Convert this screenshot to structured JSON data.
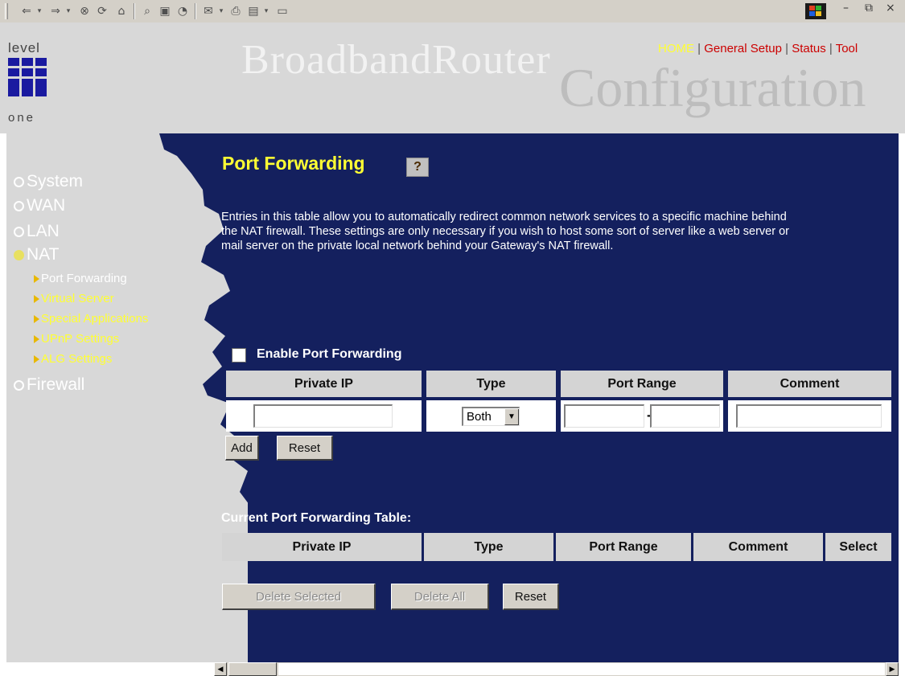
{
  "toolbar": {
    "icons": [
      "back-icon",
      "forward-icon",
      "stop-icon",
      "refresh-icon",
      "home-icon",
      "search-icon",
      "favorites-icon",
      "history-icon",
      "mail-icon",
      "print-icon",
      "edit-icon",
      "discuss-icon"
    ]
  },
  "header": {
    "logo_top": "level",
    "logo_bottom": "one",
    "brand_main": "BroadbandRouter",
    "brand_sub": "Configuration",
    "nav": {
      "home": "HOME",
      "sep": " | ",
      "general_setup": "General Setup",
      "status": "Status",
      "tool": "Tool"
    }
  },
  "sidebar": {
    "items": [
      {
        "label": "System"
      },
      {
        "label": "WAN"
      },
      {
        "label": "LAN"
      },
      {
        "label": "NAT"
      },
      {
        "label": "Firewall"
      }
    ],
    "subitems": [
      {
        "label": "Port Forwarding"
      },
      {
        "label": "Virtual Server"
      },
      {
        "label": "Special Applications"
      },
      {
        "label": "UPnP Settings"
      },
      {
        "label": "ALG Settings"
      }
    ]
  },
  "main": {
    "title": "Port Forwarding",
    "description": "Entries in this table allow you to automatically redirect common network services to a specific machine behind the NAT firewall. These settings are only necessary if you wish to host some sort of server like a web server or mail server on the private local network behind your Gateway's NAT firewall.",
    "enable_label": "Enable Port Forwarding",
    "form_headers": [
      "Private IP",
      "Type",
      "Port Range",
      "Comment"
    ],
    "type_value": "Both",
    "range_dash": "-",
    "add_button": "Add",
    "reset_button": "Reset",
    "current_title": "Current Port Forwarding Table:",
    "table_headers": [
      "Private IP",
      "Type",
      "Port Range",
      "Comment",
      "Select"
    ],
    "delete_selected": "Delete Selected",
    "delete_all": "Delete All",
    "reset2": "Reset"
  },
  "colors": {
    "content_bg": "#14205e",
    "accent_yellow": "#ffff33",
    "link_red": "#cc0000"
  }
}
